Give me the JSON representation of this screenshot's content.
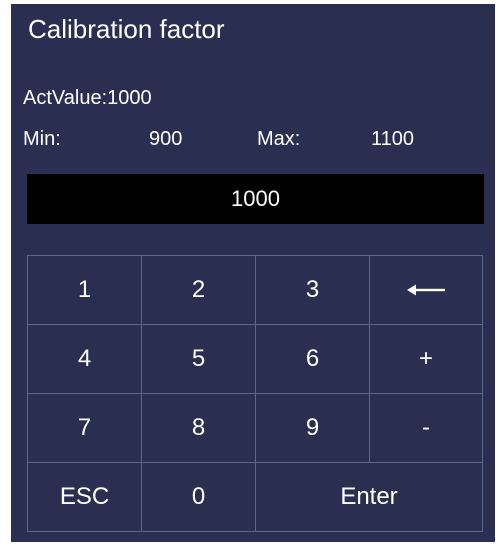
{
  "dialog": {
    "title": "Calibration factor",
    "act_value": "ActValue:1000",
    "min_label": "Min:",
    "min_value": "900",
    "max_label": "Max:",
    "max_value": "1100",
    "input_value": "1000"
  },
  "keypad": {
    "k1": "1",
    "k2": "2",
    "k3": "3",
    "backspace_icon": "left-arrow",
    "k4": "4",
    "k5": "5",
    "k6": "6",
    "plus": "+",
    "k7": "7",
    "k8": "8",
    "k9": "9",
    "minus": "-",
    "esc": "ESC",
    "k0": "0",
    "enter": "Enter"
  },
  "colors": {
    "background": "#2a2e50",
    "display_bg": "#000000",
    "grid_lines": "#626686",
    "text": "#ffffff"
  }
}
